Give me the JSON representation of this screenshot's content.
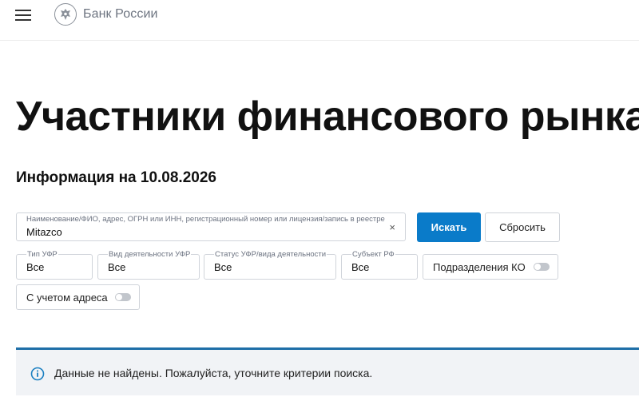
{
  "header": {
    "logo_text": "Банк России"
  },
  "page": {
    "title": "Участники финансового рынка",
    "info_date": "Информация на 10.08.2026"
  },
  "search": {
    "label": "Наименование/ФИО, адрес, ОГРН или ИНН, регистрационный номер или лицензия/запись в реестре",
    "value": "Mitazco",
    "clear_symbol": "×",
    "search_button": "Искать",
    "reset_button": "Сбросить"
  },
  "filters": [
    {
      "label": "Тип УФР",
      "value": "Все"
    },
    {
      "label": "Вид деятельности УФР",
      "value": "Все"
    },
    {
      "label": "Статус УФР/вида деятельности",
      "value": "Все"
    },
    {
      "label": "Субъект РФ",
      "value": "Все"
    }
  ],
  "toggles": {
    "branches": {
      "label": "Подразделения КО",
      "on": false
    },
    "with_address": {
      "label": "С учетом адреса",
      "on": false
    }
  },
  "alert": {
    "message": "Данные не найдены. Пожалуйста, уточните критерии поиска."
  },
  "colors": {
    "primary": "#0a7bc9",
    "alert_border": "#1f6fa8",
    "alert_bg": "#f1f3f6",
    "info_icon": "#1a7fc1"
  },
  "icons": {
    "menu": "hamburger-icon",
    "logo": "bank-emblem-icon",
    "clear": "close-icon",
    "info": "info-circle-icon"
  }
}
